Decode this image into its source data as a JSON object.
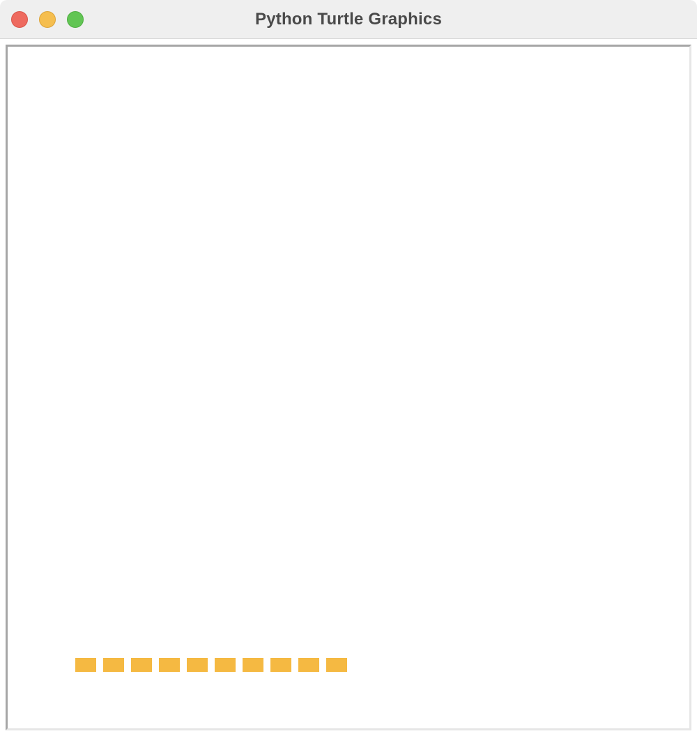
{
  "window": {
    "title": "Python Turtle Graphics"
  },
  "controls": {
    "close": {
      "icon": "close-dot-icon",
      "color": "#ee6a5f"
    },
    "minimize": {
      "icon": "minimize-dot-icon",
      "color": "#f5be4f"
    },
    "zoom": {
      "icon": "zoom-dot-icon",
      "color": "#62c554"
    }
  },
  "canvas": {
    "background": "#ffffff",
    "blocks": {
      "count": 10,
      "color": "#f5b942"
    }
  }
}
